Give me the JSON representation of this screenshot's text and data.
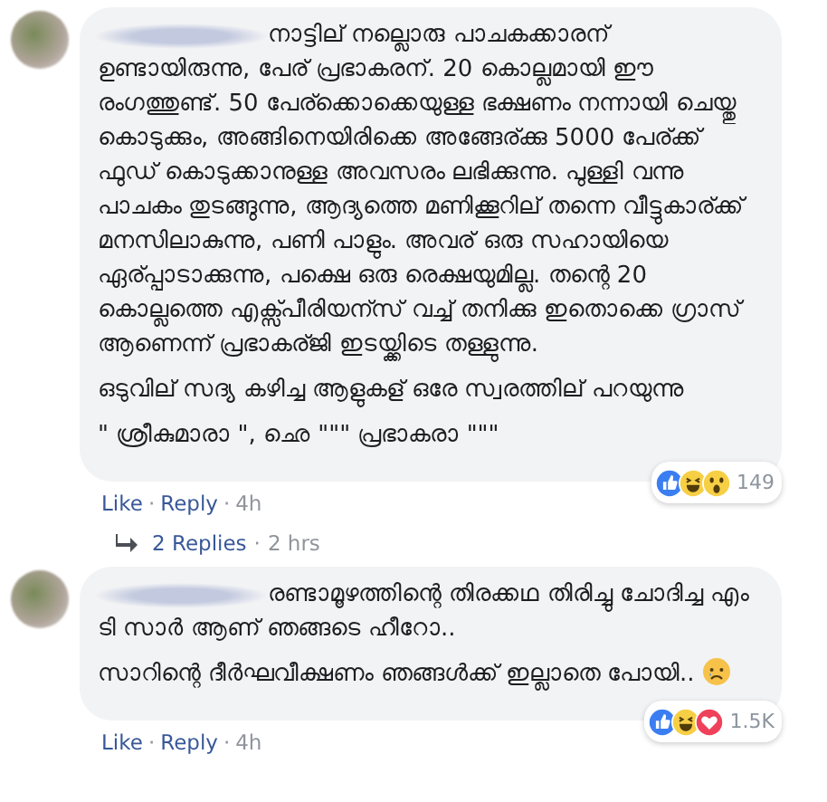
{
  "comments": [
    {
      "paragraphs": [
        {
          "text": "നാട്ടില് നല്ലൊരു പാചകക്കാരന് ഉണ്ടായിരുന്നു, പേര് പ്രഭാകരന്. 20 കൊല്ലമായി ഈ രംഗത്തുണ്ട്. 50 പേര്ക്കൊക്കെയുള്ള ഭക്ഷണം നന്നായി ചെയ്തു കൊടുക്കും, അങ്ങിനെയിരിക്കെ അങ്ങേര്ക്കു 5000 പേര്ക്ക് ഫുഡ് കൊടുക്കാനുള്ള അവസരം ലഭിക്കുന്നു. പുള്ളി വന്നു പാചകം തുടങ്ങുന്നു, ആദ്യത്തെ മണിക്കൂറില് തന്നെ വീട്ടുകാര്ക്ക് മനസിലാകുന്നു, പണി പാളും. അവര് ഒരു സഹായിയെ ഏര്പ്പാടാക്കുന്നു, പക്ഷെ ഒരു രെക്ഷയുമില്ല. തന്റെ 20 കൊല്ലത്തെ എക്സ്പീരിയന്സ് വച്ച് തനിക്കു ഇതൊക്കെ ഗ്രാസ് ആണെന്ന് പ്രഭാകര്ജി ഇടയ്ക്കിടെ തള്ളുന്നു."
        },
        {
          "text": "ഒടുവില് സദ്യ കഴിച്ച ആളുകള് ഒരേ സ്വരത്തില് പറയുന്നു"
        },
        {
          "text": "\" ശ്രീകുമാരാ \", ഛെ \"\"\" പ്രഭാകരാ \"\"\""
        }
      ],
      "reactions": [
        {
          "kind": "like"
        },
        {
          "kind": "haha"
        },
        {
          "kind": "wow"
        }
      ],
      "reaction_count": "149",
      "footer": [
        {
          "kind": "link",
          "text": "Like"
        },
        {
          "kind": "sep",
          "text": "·"
        },
        {
          "kind": "link",
          "text": "Reply"
        },
        {
          "kind": "sep",
          "text": "·"
        },
        {
          "kind": "time",
          "text": "4h"
        }
      ],
      "replies": {
        "label": "2 Replies",
        "separator": "·",
        "time": "2 hrs"
      }
    },
    {
      "paragraphs": [
        {
          "text": "രണ്ടാമൂഴത്തിന്റെ തിരക്കഥ തിരിച്ചു ചോദിച്ച എം ടി സാർ ആണ് ഞങ്ങടെ ഹീറോ.."
        },
        {
          "text": "സാറിന്റെ ദീർഘവീക്ഷണം ഞങ്ങൾക്ക് ഇല്ലാതെ പോയി..",
          "kind": "with_sad_emoji"
        }
      ],
      "reactions": [
        {
          "kind": "like"
        },
        {
          "kind": "haha"
        },
        {
          "kind": "love"
        }
      ],
      "reaction_count": "1.5K",
      "footer": [
        {
          "kind": "link",
          "text": "Like"
        },
        {
          "kind": "sep",
          "text": "·"
        },
        {
          "kind": "link",
          "text": "Reply"
        },
        {
          "kind": "sep",
          "text": "·"
        },
        {
          "kind": "time",
          "text": "4h"
        }
      ]
    }
  ]
}
